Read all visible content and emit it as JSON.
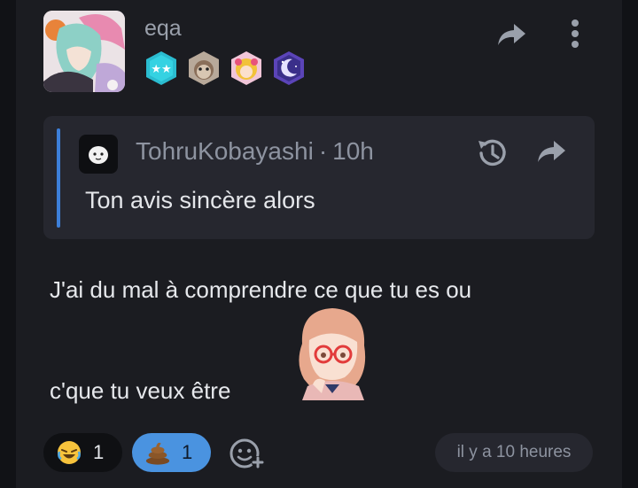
{
  "post": {
    "username": "eqa",
    "badges": [
      "two-star-badge",
      "cat-badge",
      "anime-girl-badge",
      "moon-badge"
    ],
    "quote": {
      "author": "TohruKobayashi",
      "separator": "·",
      "time": "10h",
      "text": "Ton avis sincère alors"
    },
    "body_line1": "J'ai du mal à comprendre ce que tu es ou",
    "body_line2": "c'que tu veux être",
    "reactions": [
      {
        "icon": "laughing-face-icon",
        "count": "1"
      },
      {
        "icon": "poop-icon",
        "count": "1"
      }
    ],
    "timestamp": "il y a 10 heures"
  },
  "colors": {
    "background": "#111216",
    "card": "#1b1c21",
    "quote_bg": "#26272f",
    "accent": "#3d7fd9",
    "reaction_active": "#4a93e0"
  }
}
